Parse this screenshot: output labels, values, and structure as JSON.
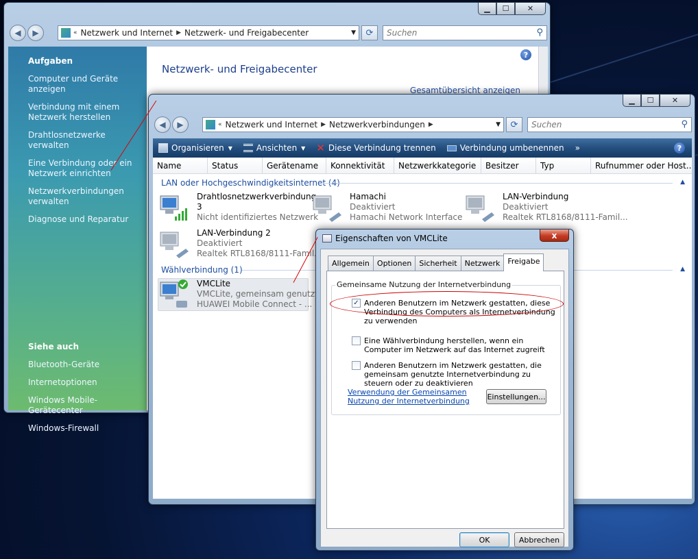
{
  "back_window": {
    "address": {
      "crumbs": [
        "Netzwerk und Internet",
        "Netzwerk- und Freigabecenter"
      ]
    },
    "search_placeholder": "Suchen",
    "sidebar": {
      "tasks_heading": "Aufgaben",
      "tasks": [
        "Computer und Geräte anzeigen",
        "Verbindung mit einem Netzwerk herstellen",
        "Drahtlosnetzwerke verwalten",
        "Eine Verbindung oder ein Netzwerk einrichten",
        "Netzwerkverbindungen verwalten",
        "Diagnose und Reparatur"
      ],
      "see_also_heading": "Siehe auch",
      "see_also": [
        "Bluetooth-Geräte",
        "Internetoptionen",
        "Windows Mobile-Gerätecenter",
        "Windows-Firewall"
      ]
    },
    "title": "Netzwerk- und Freigabecenter",
    "overview_link": "Gesamtübersicht anzeigen"
  },
  "mid_window": {
    "address": {
      "crumbs": [
        "Netzwerk und Internet",
        "Netzwerkverbindungen"
      ]
    },
    "search_placeholder": "Suchen",
    "commands": {
      "organize": "Organisieren",
      "views": "Ansichten",
      "disconnect": "Diese Verbindung trennen",
      "rename": "Verbindung umbenennen",
      "more": "»"
    },
    "columns": [
      "Name",
      "Status",
      "Gerätename",
      "Konnektivität",
      "Netzwerkkategorie",
      "Besitzer",
      "Typ",
      "Rufnummer oder Host..."
    ],
    "group_lan": "LAN oder Hochgeschwindigkeitsinternet (4)",
    "group_dial": "Wählverbindung (1)",
    "connections": {
      "wifi": {
        "name": "Drahtlosnetzwerkverbindung 3",
        "status": "Nicht identifiziertes Netzwerk"
      },
      "hamachi": {
        "name": "Hamachi",
        "status": "Deaktiviert",
        "device": "Hamachi Network Interface"
      },
      "lan1": {
        "name": "LAN-Verbindung",
        "status": "Deaktiviert",
        "device": "Realtek RTL8168/8111-Famil..."
      },
      "lan2": {
        "name": "LAN-Verbindung 2",
        "status": "Deaktiviert",
        "device": "Realtek RTL8168/8111-Famil..."
      },
      "vmc": {
        "name": "VMCLite",
        "status": "VMCLite, gemeinsam genutzt",
        "device": "HUAWEI Mobile Connect - ..."
      }
    }
  },
  "dialog": {
    "title": "Eigenschaften von VMCLite",
    "close": "x",
    "tabs": [
      "Allgemein",
      "Optionen",
      "Sicherheit",
      "Netzwerk",
      "Freigabe"
    ],
    "active_tab": "Freigabe",
    "group_label": "Gemeinsame Nutzung der Internetverbindung",
    "checkboxes": [
      {
        "label": "Anderen Benutzern im Netzwerk gestatten, diese Verbindung des Computers als Internetverbindung zu verwenden",
        "checked": true
      },
      {
        "label": "Eine Wählverbindung herstellen, wenn ein Computer im Netzwerk auf das Internet zugreift",
        "checked": false
      },
      {
        "label": "Anderen Benutzern im Netzwerk gestatten, die gemeinsam genutzte Internetverbindung zu steuern oder zu deaktivieren",
        "checked": false
      }
    ],
    "help_link": "Verwendung der Gemeinsamen Nutzung der Internetverbindung",
    "settings_button": "Einstellungen...",
    "ok_button": "OK",
    "cancel_button": "Abbrechen"
  },
  "colors": {
    "link_blue": "#1e4ea0",
    "annotation_red": "#cc0000",
    "command_bar": "#244e7e"
  }
}
